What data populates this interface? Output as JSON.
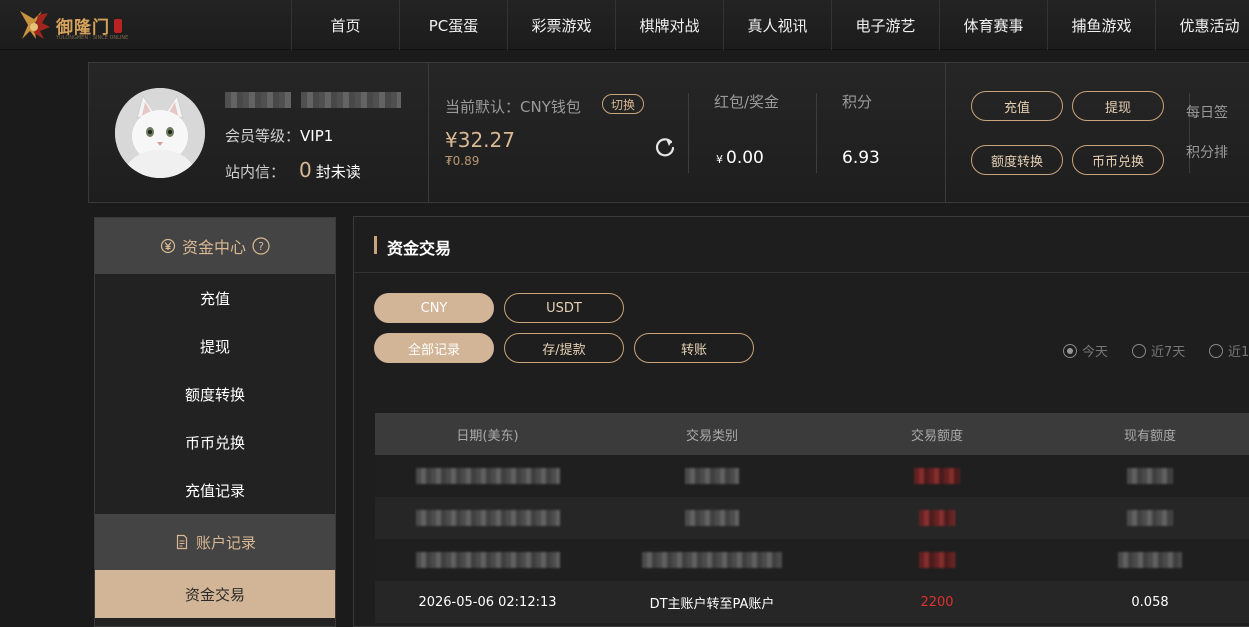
{
  "brand": {
    "name": "御隆门",
    "tagline": "YULONGMEN · SINCE ONLINE"
  },
  "nav": [
    "首页",
    "PC蛋蛋",
    "彩票游戏",
    "棋牌对战",
    "真人视讯",
    "电子游艺",
    "体育赛事",
    "捕鱼游戏",
    "优惠活动"
  ],
  "user": {
    "level_label": "会员等级：",
    "level": "VIP1",
    "inbox_label": "站内信：",
    "inbox_count": "0",
    "inbox_unit": "封未读"
  },
  "wallet": {
    "label": "当前默认：CNY钱包",
    "switch_label": "切换",
    "balance": "¥32.27",
    "sub_balance": "₮0.89"
  },
  "stats": {
    "bonus_label": "红包/奖金",
    "bonus_currency": "¥",
    "bonus_value": "0.00",
    "points_label": "积分",
    "points_value": "6.93"
  },
  "actions": {
    "deposit": "充值",
    "withdraw": "提现",
    "transfer": "额度转换",
    "exchange": "币币兑换"
  },
  "extra": {
    "checkin": "每日签",
    "points_cut": "积分排"
  },
  "sidebar": {
    "head1": "资金中心",
    "items": [
      "充值",
      "提现",
      "额度转换",
      "币币兑换",
      "充值记录"
    ],
    "head2": "账户记录",
    "active": "资金交易"
  },
  "main": {
    "title": "资金交易",
    "currency_tabs": [
      "CNY",
      "USDT"
    ],
    "type_tabs": [
      "全部记录",
      "存/提款",
      "转账"
    ],
    "range": [
      "今天",
      "近7天",
      "近1"
    ]
  },
  "table": {
    "headers": [
      "日期(美东)",
      "交易类别",
      "交易额度",
      "现有额度"
    ],
    "row": [
      "2026-05-06 02:12:13",
      "DT主账户转至PA账户",
      "2200",
      "0.058"
    ]
  },
  "colors": {
    "accent": "#d2b496",
    "gold": "#d9b893",
    "negative": "#e0302e"
  }
}
